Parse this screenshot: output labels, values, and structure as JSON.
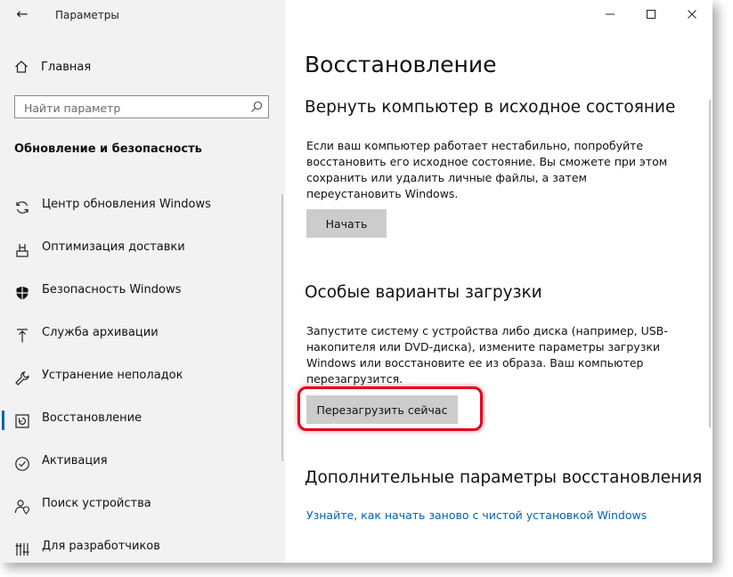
{
  "window": {
    "title": "Параметры"
  },
  "sidebar": {
    "home_label": "Главная",
    "search_placeholder": "Найти параметр",
    "section_title": "Обновление и безопасность",
    "items": [
      {
        "label": "Центр обновления Windows",
        "icon": "sync-icon"
      },
      {
        "label": "Оптимизация доставки",
        "icon": "delivery-icon"
      },
      {
        "label": "Безопасность Windows",
        "icon": "shield-icon"
      },
      {
        "label": "Служба архивации",
        "icon": "upload-arrow-icon"
      },
      {
        "label": "Устранение неполадок",
        "icon": "wrench-icon"
      },
      {
        "label": "Восстановление",
        "icon": "restore-icon",
        "active": true
      },
      {
        "label": "Активация",
        "icon": "check-circle-icon"
      },
      {
        "label": "Поиск устройства",
        "icon": "person-location-icon"
      },
      {
        "label": "Для разработчиков",
        "icon": "developer-icon"
      }
    ]
  },
  "main": {
    "title": "Восстановление",
    "reset": {
      "heading": "Вернуть компьютер в исходное состояние",
      "text": "Если ваш компьютер работает нестабильно, попробуйте восстановить его исходное состояние. Вы сможете при этом сохранить или удалить личные файлы, а затем переустановить Windows.",
      "button": "Начать"
    },
    "advanced_startup": {
      "heading": "Особые варианты загрузки",
      "text": "Запустите систему с устройства либо диска (например, USB-накопителя или DVD-диска), измените параметры загрузки Windows или восстановите ее из образа. Ваш компьютер перезагрузится.",
      "button": "Перезагрузить сейчас"
    },
    "more_options": {
      "heading": "Дополнительные параметры восстановления",
      "link": "Узнайте, как начать заново с чистой установкой Windows"
    }
  },
  "colors": {
    "accent": "#0063b1",
    "highlight": "#e3001b",
    "sidebar_bg": "#f2f2f2",
    "button_bg": "#cccccc"
  }
}
